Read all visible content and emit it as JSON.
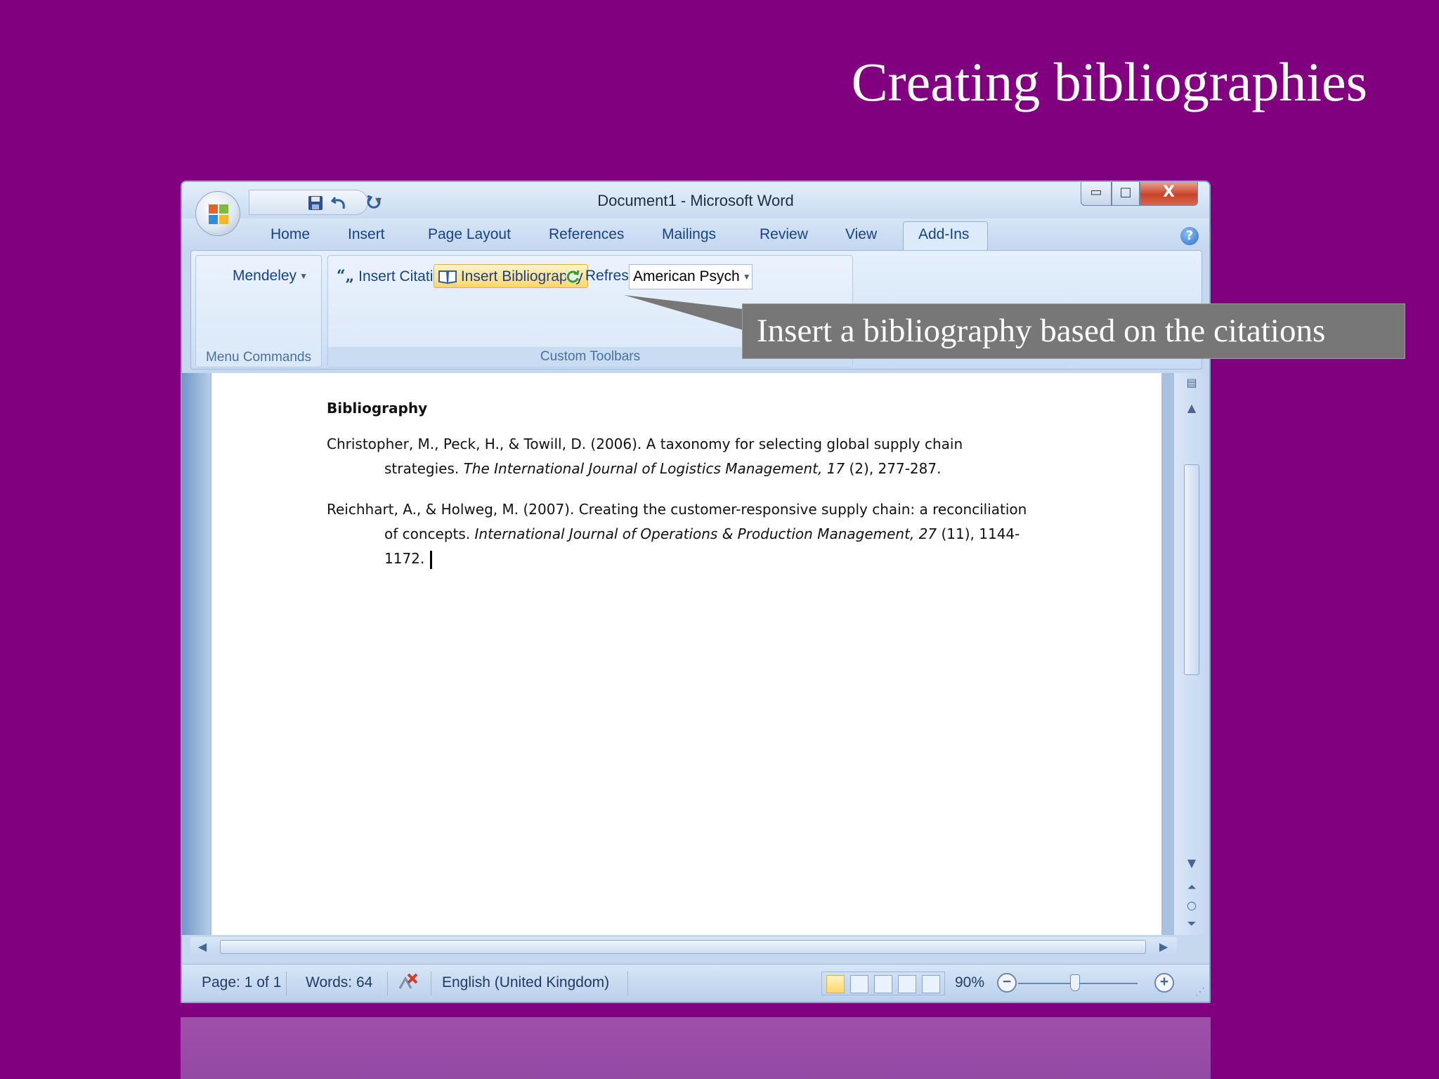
{
  "slide": {
    "title": "Creating bibliographies"
  },
  "window": {
    "title": "Document1 - Microsoft Word",
    "controls": {
      "minimize": "▭",
      "maximize": "□",
      "close": "X"
    }
  },
  "tabs": [
    "Home",
    "Insert",
    "Page Layout",
    "References",
    "Mailings",
    "Review",
    "View",
    "Add-Ins"
  ],
  "active_tab": "Add-Ins",
  "ribbon": {
    "mendeley": "Mendeley",
    "insert_citation": "Insert Citation",
    "insert_bibliography": "Insert Bibliography",
    "refresh": "Refresh",
    "style_select": "American Psych",
    "group_menu_commands": "Menu Commands",
    "group_custom_toolbars": "Custom Toolbars"
  },
  "callout": {
    "text": "Insert a bibliography based on the citations"
  },
  "document": {
    "heading": "Bibliography",
    "entries": [
      {
        "prefix": "Christopher, M., Peck, H., & Towill, D. (2006). A taxonomy for selecting global supply chain strategies. ",
        "journal": "The International Journal of Logistics Management, 17",
        "suffix": " (2), 277-287."
      },
      {
        "prefix": "Reichhart, A., & Holweg, M. (2007). Creating the customer-responsive supply chain: a reconciliation of concepts. ",
        "journal": "International Journal of Operations & Production Management, 27",
        "suffix": " (11), 1144-1172."
      }
    ]
  },
  "status": {
    "page": "Page: 1 of 1",
    "words": "Words: 64",
    "language": "English (United Kingdom)",
    "zoom": "90%",
    "zoom_minus": "−",
    "zoom_plus": "+"
  },
  "icons": [
    "office-button-icon",
    "save-icon",
    "undo-icon",
    "redo-icon",
    "help-icon",
    "quote-icon",
    "book-icon",
    "refresh-icon",
    "spellcheck-icon"
  ],
  "colors": {
    "slide_background": "#800080",
    "active_button": "#ffd66b",
    "callout": "#777777"
  }
}
